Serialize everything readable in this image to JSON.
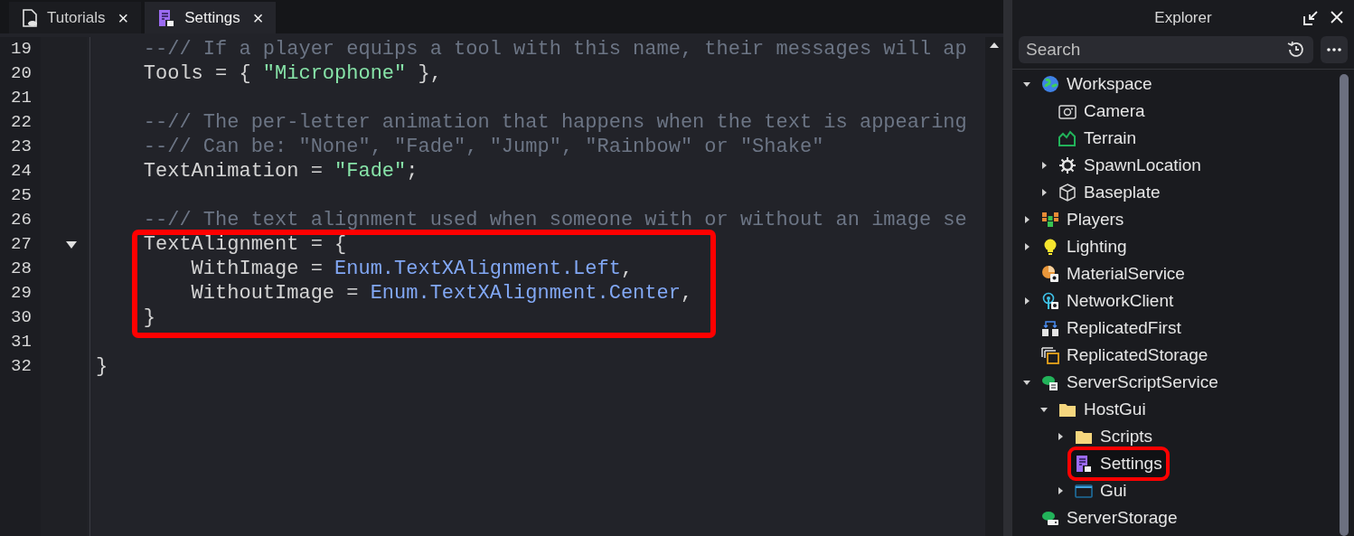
{
  "tabs": [
    {
      "label": "Tutorials",
      "kind": "document",
      "selected": false,
      "close": "×"
    },
    {
      "label": "Settings",
      "kind": "module",
      "selected": true,
      "close": "×"
    }
  ],
  "editor": {
    "lines": [
      {
        "number": "19",
        "tokens": [
          {
            "kind": "comment",
            "text": "    --// If a player equips a tool with this name, their messages will ap"
          }
        ]
      },
      {
        "number": "20",
        "tokens": [
          {
            "kind": "plain",
            "text": "    Tools = { "
          },
          {
            "kind": "string",
            "text": "\"Microphone\""
          },
          {
            "kind": "plain",
            "text": " },"
          }
        ]
      },
      {
        "number": "21"
      },
      {
        "number": "22",
        "tokens": [
          {
            "kind": "comment",
            "text": "    --// The per-letter animation that happens when the text is appearing"
          }
        ]
      },
      {
        "number": "23",
        "tokens": [
          {
            "kind": "comment",
            "text": "    --// Can be: \"None\", \"Fade\", \"Jump\", \"Rainbow\" or \"Shake\""
          }
        ]
      },
      {
        "number": "24",
        "tokens": [
          {
            "kind": "plain",
            "text": "    TextAnimation = "
          },
          {
            "kind": "string",
            "text": "\"Fade\""
          },
          {
            "kind": "plain",
            "text": ";"
          }
        ]
      },
      {
        "number": "25"
      },
      {
        "number": "26",
        "tokens": [
          {
            "kind": "comment",
            "text": "    --// The text alignment used when someone with or without an image se"
          }
        ]
      },
      {
        "number": "27",
        "highlighted": true,
        "fold": {
          "expanded": true
        },
        "tokens": [
          {
            "kind": "plain",
            "text": "    TextAlignment = {"
          }
        ]
      },
      {
        "number": "28",
        "highlighted": true,
        "tokens": [
          {
            "kind": "plain",
            "text": "        WithImage = "
          },
          {
            "kind": "enum",
            "text": "Enum.TextXAlignment.Left"
          },
          {
            "kind": "plain",
            "text": ","
          }
        ]
      },
      {
        "number": "29",
        "highlighted": true,
        "tokens": [
          {
            "kind": "plain",
            "text": "        WithoutImage = "
          },
          {
            "kind": "enum",
            "text": "Enum.TextXAlignment.Center"
          },
          {
            "kind": "plain",
            "text": ","
          }
        ]
      },
      {
        "number": "30",
        "highlighted": true,
        "tokens": [
          {
            "kind": "plain",
            "text": "    }"
          }
        ]
      },
      {
        "number": "31"
      },
      {
        "number": "32",
        "tokens": [
          {
            "kind": "plain",
            "text": "}"
          }
        ]
      }
    ]
  },
  "explorer": {
    "title": "Explorer",
    "search": {
      "placeholder": "Search"
    },
    "tree": [
      {
        "label": "Workspace",
        "kind": "globe",
        "expanded": true,
        "selected": false,
        "children": [
          {
            "label": "Camera",
            "kind": "camera",
            "selected": false
          },
          {
            "label": "Terrain",
            "kind": "terrain",
            "selected": false
          },
          {
            "label": "SpawnLocation",
            "kind": "spawn",
            "expanded": false,
            "selected": false
          },
          {
            "label": "Baseplate",
            "kind": "cube",
            "expanded": false,
            "selected": false
          }
        ]
      },
      {
        "label": "Players",
        "kind": "players",
        "expanded": false,
        "selected": false
      },
      {
        "label": "Lighting",
        "kind": "bulb",
        "expanded": false,
        "selected": false
      },
      {
        "label": "MaterialService",
        "kind": "material",
        "selected": false
      },
      {
        "label": "NetworkClient",
        "kind": "network",
        "expanded": false,
        "selected": false
      },
      {
        "label": "ReplicatedFirst",
        "kind": "replicatedfirst",
        "selected": false
      },
      {
        "label": "ReplicatedStorage",
        "kind": "storage",
        "selected": false
      },
      {
        "label": "ServerScriptService",
        "kind": "serverscript",
        "expanded": true,
        "selected": false,
        "children": [
          {
            "label": "HostGui",
            "kind": "folder",
            "expanded": true,
            "selected": false,
            "children": [
              {
                "label": "Scripts",
                "kind": "folder",
                "expanded": false,
                "selected": false
              },
              {
                "label": "Settings",
                "kind": "module",
                "selected": true
              },
              {
                "label": "Gui",
                "kind": "gui",
                "expanded": false,
                "selected": false
              }
            ]
          }
        ]
      },
      {
        "label": "ServerStorage",
        "kind": "serverstorage",
        "selected": false
      }
    ]
  }
}
